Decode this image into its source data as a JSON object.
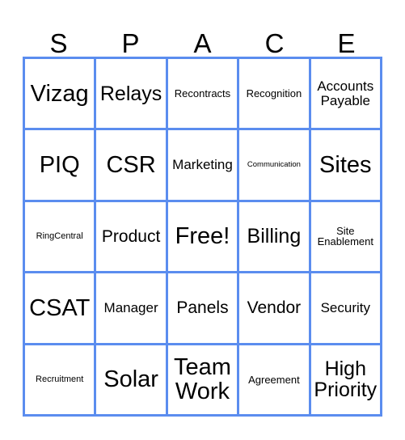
{
  "card": {
    "title_letters": [
      "S",
      "P",
      "A",
      "C",
      "E"
    ],
    "accent_color": "#5b8def",
    "background_color": "#ffffff",
    "text_color": "#000000",
    "grid_size": "5x5",
    "free_space_label": "Free!"
  },
  "cells": [
    {
      "label": "Vizag",
      "size": "t-xxl",
      "row": 1,
      "col": 1
    },
    {
      "label": "Relays",
      "size": "t-xl",
      "row": 1,
      "col": 2
    },
    {
      "label": "Recontracts",
      "size": "t-sm",
      "row": 1,
      "col": 3
    },
    {
      "label": "Recognition",
      "size": "t-sm",
      "row": 1,
      "col": 4
    },
    {
      "label": "Accounts\nPayable",
      "size": "t-md",
      "row": 1,
      "col": 5
    },
    {
      "label": "PIQ",
      "size": "t-xxl",
      "row": 2,
      "col": 1
    },
    {
      "label": "CSR",
      "size": "t-xxl",
      "row": 2,
      "col": 2
    },
    {
      "label": "Marketing",
      "size": "t-md",
      "row": 2,
      "col": 3
    },
    {
      "label": "Communication",
      "size": "t-xxs",
      "row": 2,
      "col": 4
    },
    {
      "label": "Sites",
      "size": "t-xxl",
      "row": 2,
      "col": 5
    },
    {
      "label": "RingCentral",
      "size": "t-xs",
      "row": 3,
      "col": 1
    },
    {
      "label": "Product",
      "size": "t-lg",
      "row": 3,
      "col": 2
    },
    {
      "label": "Free!",
      "size": "t-xxl",
      "row": 3,
      "col": 3
    },
    {
      "label": "Billing",
      "size": "t-xl",
      "row": 3,
      "col": 4
    },
    {
      "label": "Site\nEnablement",
      "size": "t-sm",
      "row": 3,
      "col": 5
    },
    {
      "label": "CSAT",
      "size": "t-xxl",
      "row": 4,
      "col": 1
    },
    {
      "label": "Manager",
      "size": "t-md",
      "row": 4,
      "col": 2
    },
    {
      "label": "Panels",
      "size": "t-lg",
      "row": 4,
      "col": 3
    },
    {
      "label": "Vendor",
      "size": "t-lg",
      "row": 4,
      "col": 4
    },
    {
      "label": "Security",
      "size": "t-md",
      "row": 4,
      "col": 5
    },
    {
      "label": "Recruitment",
      "size": "t-xs",
      "row": 5,
      "col": 1
    },
    {
      "label": "Solar",
      "size": "t-xxl",
      "row": 5,
      "col": 2
    },
    {
      "label": "Team\nWork",
      "size": "t-xxl",
      "row": 5,
      "col": 3
    },
    {
      "label": "Agreement",
      "size": "t-sm",
      "row": 5,
      "col": 4
    },
    {
      "label": "High\nPriority",
      "size": "t-xl",
      "row": 5,
      "col": 5
    }
  ]
}
